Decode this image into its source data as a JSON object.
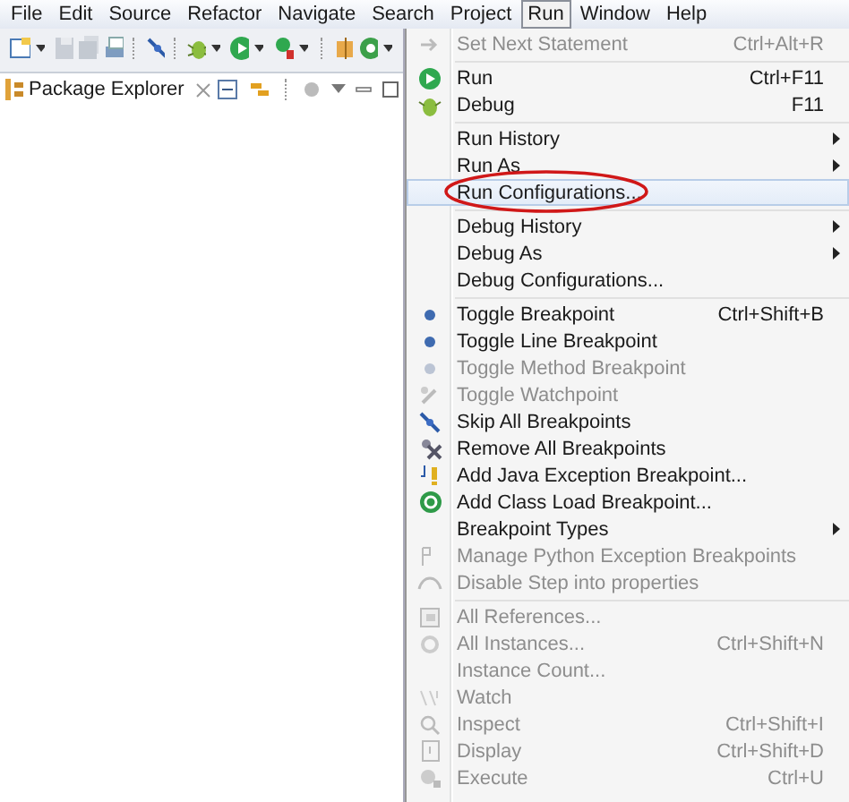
{
  "menubar": [
    {
      "label": "File",
      "selected": false
    },
    {
      "label": "Edit",
      "selected": false
    },
    {
      "label": "Source",
      "selected": false
    },
    {
      "label": "Refactor",
      "selected": false
    },
    {
      "label": "Navigate",
      "selected": false
    },
    {
      "label": "Search",
      "selected": false
    },
    {
      "label": "Project",
      "selected": false
    },
    {
      "label": "Run",
      "selected": true
    },
    {
      "label": "Window",
      "selected": false
    },
    {
      "label": "Help",
      "selected": false
    }
  ],
  "view_tab": {
    "label": "Package Explorer"
  },
  "run_menu": [
    {
      "kind": "item",
      "label": "Set Next Statement",
      "shortcut": "Ctrl+Alt+R",
      "disabled": true,
      "selected": false,
      "circled": false
    },
    {
      "kind": "separator"
    },
    {
      "kind": "item",
      "label": "Run",
      "shortcut": "Ctrl+F11",
      "disabled": false,
      "selected": false,
      "circled": false
    },
    {
      "kind": "item",
      "label": "Debug",
      "shortcut": "F11",
      "disabled": false,
      "selected": false,
      "circled": false
    },
    {
      "kind": "separator"
    },
    {
      "kind": "submenu",
      "label": "Run History",
      "disabled": false,
      "selected": false,
      "circled": false
    },
    {
      "kind": "submenu",
      "label": "Run As",
      "disabled": false,
      "selected": false,
      "circled": false
    },
    {
      "kind": "item",
      "label": "Run Configurations...",
      "disabled": false,
      "selected": true,
      "circled": true
    },
    {
      "kind": "separator"
    },
    {
      "kind": "submenu",
      "label": "Debug History",
      "disabled": false,
      "selected": false,
      "circled": false
    },
    {
      "kind": "submenu",
      "label": "Debug As",
      "disabled": false,
      "selected": false,
      "circled": false
    },
    {
      "kind": "item",
      "label": "Debug Configurations...",
      "disabled": false,
      "selected": false,
      "circled": false
    },
    {
      "kind": "separator"
    },
    {
      "kind": "item",
      "label": "Toggle Breakpoint",
      "shortcut": "Ctrl+Shift+B",
      "disabled": false,
      "selected": false,
      "circled": false
    },
    {
      "kind": "item",
      "label": "Toggle Line Breakpoint",
      "disabled": false,
      "selected": false,
      "circled": false
    },
    {
      "kind": "item",
      "label": "Toggle Method Breakpoint",
      "disabled": true,
      "selected": false,
      "circled": false
    },
    {
      "kind": "item",
      "label": "Toggle Watchpoint",
      "disabled": true,
      "selected": false,
      "circled": false
    },
    {
      "kind": "item",
      "label": "Skip All Breakpoints",
      "disabled": false,
      "selected": false,
      "circled": false
    },
    {
      "kind": "item",
      "label": "Remove All Breakpoints",
      "disabled": false,
      "selected": false,
      "circled": false
    },
    {
      "kind": "item",
      "label": "Add Java Exception Breakpoint...",
      "disabled": false,
      "selected": false,
      "circled": false
    },
    {
      "kind": "item",
      "label": "Add Class Load Breakpoint...",
      "disabled": false,
      "selected": false,
      "circled": false
    },
    {
      "kind": "submenu",
      "label": "Breakpoint Types",
      "disabled": false,
      "selected": false,
      "circled": false
    },
    {
      "kind": "item",
      "label": "Manage Python Exception Breakpoints",
      "disabled": true,
      "selected": false,
      "circled": false
    },
    {
      "kind": "item",
      "label": "Disable Step into properties",
      "disabled": true,
      "selected": false,
      "circled": false
    },
    {
      "kind": "separator"
    },
    {
      "kind": "item",
      "label": "All References...",
      "disabled": true,
      "selected": false,
      "circled": false
    },
    {
      "kind": "item",
      "label": "All Instances...",
      "shortcut": "Ctrl+Shift+N",
      "disabled": true,
      "selected": false,
      "circled": false
    },
    {
      "kind": "item",
      "label": "Instance Count...",
      "disabled": true,
      "selected": false,
      "circled": false
    },
    {
      "kind": "item",
      "label": "Watch",
      "disabled": true,
      "selected": false,
      "circled": false
    },
    {
      "kind": "item",
      "label": "Inspect",
      "shortcut": "Ctrl+Shift+I",
      "disabled": true,
      "selected": false,
      "circled": false
    },
    {
      "kind": "item",
      "label": "Display",
      "shortcut": "Ctrl+Shift+D",
      "disabled": true,
      "selected": false,
      "circled": false
    },
    {
      "kind": "item",
      "label": "Execute",
      "shortcut": "Ctrl+U",
      "disabled": true,
      "selected": false,
      "circled": false
    }
  ]
}
